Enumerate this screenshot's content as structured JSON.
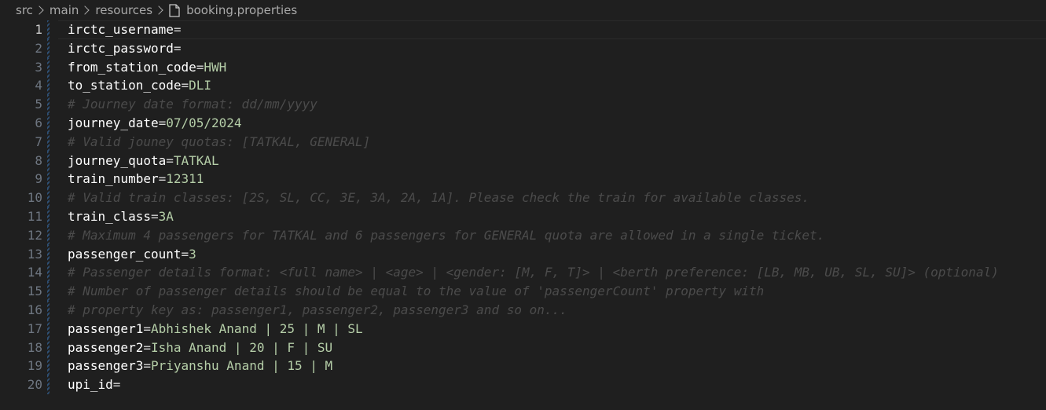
{
  "breadcrumb": {
    "items": [
      "src",
      "main",
      "resources"
    ],
    "file_name": "booking.properties",
    "file_icon": "file-icon"
  },
  "editor": {
    "current_line": 1,
    "lines": [
      {
        "num": "1",
        "type": "prop",
        "key": "irctc_username",
        "eq": "=",
        "value": ""
      },
      {
        "num": "2",
        "type": "prop",
        "key": "irctc_password",
        "eq": "=",
        "value": ""
      },
      {
        "num": "3",
        "type": "prop",
        "key": "from_station_code",
        "eq": "=",
        "value": "HWH"
      },
      {
        "num": "4",
        "type": "prop",
        "key": "to_station_code",
        "eq": "=",
        "value": "DLI"
      },
      {
        "num": "5",
        "type": "comment",
        "text": "# Journey date format: dd/mm/yyyy"
      },
      {
        "num": "6",
        "type": "prop",
        "key": "journey_date",
        "eq": "=",
        "value": "07/05/2024"
      },
      {
        "num": "7",
        "type": "comment",
        "text": "# Valid jouney quotas: [TATKAL, GENERAL]"
      },
      {
        "num": "8",
        "type": "prop",
        "key": "journey_quota",
        "eq": "=",
        "value": "TATKAL"
      },
      {
        "num": "9",
        "type": "prop",
        "key": "train_number",
        "eq": "=",
        "value": "12311"
      },
      {
        "num": "10",
        "type": "comment",
        "text": "# Valid train classes: [2S, SL, CC, 3E, 3A, 2A, 1A]. Please check the train for available classes."
      },
      {
        "num": "11",
        "type": "prop",
        "key": "train_class",
        "eq": "=",
        "value": "3A"
      },
      {
        "num": "12",
        "type": "comment",
        "text": "# Maximum 4 passengers for TATKAL and 6 passengers for GENERAL quota are allowed in a single ticket."
      },
      {
        "num": "13",
        "type": "prop",
        "key": "passenger_count",
        "eq": "=",
        "value": "3"
      },
      {
        "num": "14",
        "type": "comment",
        "text": "# Passenger details format: <full name> | <age> | <gender: [M, F, T]> | <berth preference: [LB, MB, UB, SL, SU]> (optional)"
      },
      {
        "num": "15",
        "type": "comment",
        "text": "# Number of passenger details should be equal to the value of 'passengerCount' property with"
      },
      {
        "num": "16",
        "type": "comment",
        "text": "# property key as: passenger1, passenger2, passenger3 and so on..."
      },
      {
        "num": "17",
        "type": "prop",
        "key": "passenger1",
        "eq": "=",
        "value": "Abhishek Anand | 25 | M | SL"
      },
      {
        "num": "18",
        "type": "prop",
        "key": "passenger2",
        "eq": "=",
        "value": "Isha Anand | 20 | F | SU"
      },
      {
        "num": "19",
        "type": "prop",
        "key": "passenger3",
        "eq": "=",
        "value": "Priyanshu Anand | 15 | M"
      },
      {
        "num": "20",
        "type": "prop",
        "key": "upi_id",
        "eq": "=",
        "value": ""
      }
    ]
  },
  "colors": {
    "background": "#1f1f1f",
    "key": "#ffffff",
    "value": "#b5cea8",
    "comment": "#4b4b4b",
    "line_number": "#6e7681",
    "gutter_bar": "#2e4f73"
  }
}
